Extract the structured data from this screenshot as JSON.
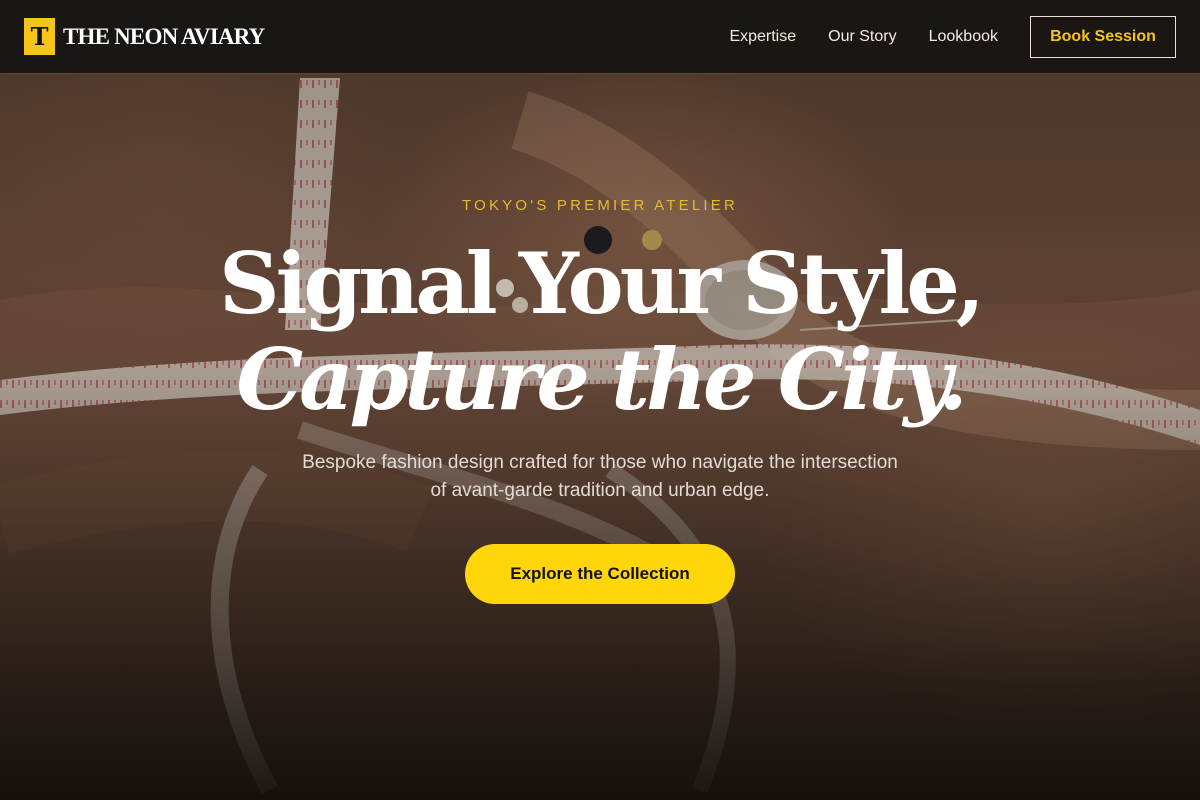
{
  "header": {
    "logo_letter": "T",
    "brand_name": "THE NEON AVIARY",
    "nav": [
      {
        "label": "Expertise"
      },
      {
        "label": "Our Story"
      },
      {
        "label": "Lookbook"
      }
    ],
    "book_label": "Book Session"
  },
  "hero": {
    "eyebrow": "TOKYO'S PREMIER ATELIER",
    "headline_line1": "Signal Your Style,",
    "headline_line2": "Capture the City.",
    "subtitle": "Bespoke fashion design crafted for those who navigate the intersection of avant-garde tradition and urban edge.",
    "cta_label": "Explore the Collection"
  },
  "colors": {
    "accent_yellow": "#ffd60a",
    "eyebrow_gold": "#e6b936",
    "header_bg": "#161412"
  }
}
